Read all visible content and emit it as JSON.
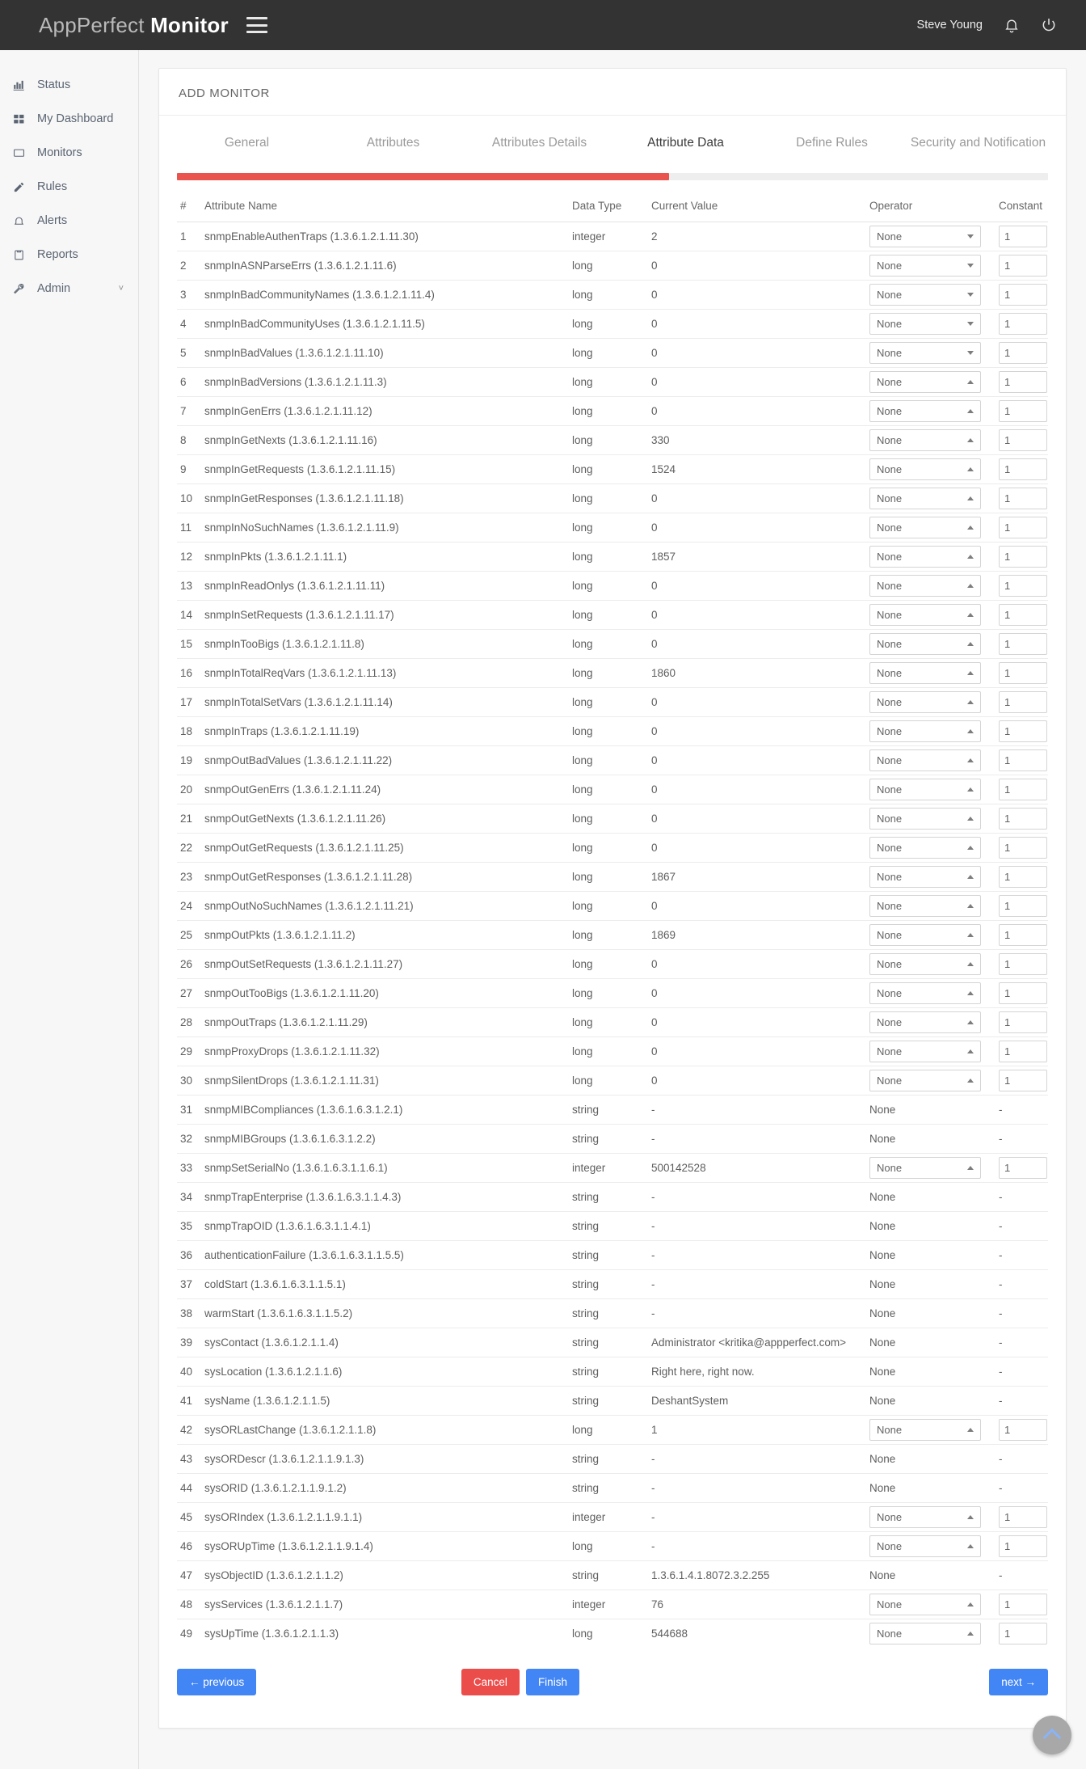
{
  "topbar": {
    "brand_light": "AppPerfect ",
    "brand_bold": "Monitor",
    "menu_icon": "hamburger-icon",
    "user_name": "Steve Young",
    "bell_icon": "bell-icon",
    "power_icon": "power-icon"
  },
  "sidebar": {
    "items": [
      {
        "label": "Status",
        "icon": "chart-bar-icon",
        "caret": ""
      },
      {
        "label": "My Dashboard",
        "icon": "grid-icon",
        "caret": ""
      },
      {
        "label": "Monitors",
        "icon": "monitor-icon",
        "caret": ""
      },
      {
        "label": "Rules",
        "icon": "pencil-icon",
        "caret": ""
      },
      {
        "label": "Alerts",
        "icon": "bell-icon",
        "caret": ""
      },
      {
        "label": "Reports",
        "icon": "clipboard-icon",
        "caret": ""
      },
      {
        "label": "Admin",
        "icon": "wrench-icon",
        "caret": "˅"
      }
    ]
  },
  "card": {
    "title": "ADD MONITOR",
    "tabs": [
      {
        "label": "General",
        "active": false
      },
      {
        "label": "Attributes",
        "active": false
      },
      {
        "label": "Attributes Details",
        "active": false
      },
      {
        "label": "Attribute Data",
        "active": true
      },
      {
        "label": "Define Rules",
        "active": false
      },
      {
        "label": "Security and Notification",
        "active": false
      }
    ],
    "progress_percent": 56.5,
    "progress_color": "#e9544f"
  },
  "table": {
    "headers": [
      "#",
      "Attribute Name",
      "Data Type",
      "Current Value",
      "Operator",
      "Constant"
    ],
    "operator_default": "None",
    "constant_default": "1",
    "dash": "-",
    "rows": [
      {
        "n": "1",
        "name": "snmpEnableAuthenTraps (1.3.6.1.2.1.11.30)",
        "type": "integer",
        "value": "2",
        "op": "None",
        "const": "1",
        "editable": true,
        "arrow": "down"
      },
      {
        "n": "2",
        "name": "snmpInASNParseErrs (1.3.6.1.2.1.11.6)",
        "type": "long",
        "value": "0",
        "op": "None",
        "const": "1",
        "editable": true,
        "arrow": "down"
      },
      {
        "n": "3",
        "name": "snmpInBadCommunityNames (1.3.6.1.2.1.11.4)",
        "type": "long",
        "value": "0",
        "op": "None",
        "const": "1",
        "editable": true,
        "arrow": "down"
      },
      {
        "n": "4",
        "name": "snmpInBadCommunityUses (1.3.6.1.2.1.11.5)",
        "type": "long",
        "value": "0",
        "op": "None",
        "const": "1",
        "editable": true,
        "arrow": "down"
      },
      {
        "n": "5",
        "name": "snmpInBadValues (1.3.6.1.2.1.11.10)",
        "type": "long",
        "value": "0",
        "op": "None",
        "const": "1",
        "editable": true,
        "arrow": "down"
      },
      {
        "n": "6",
        "name": "snmpInBadVersions (1.3.6.1.2.1.11.3)",
        "type": "long",
        "value": "0",
        "op": "None",
        "const": "1",
        "editable": true,
        "arrow": "up"
      },
      {
        "n": "7",
        "name": "snmpInGenErrs (1.3.6.1.2.1.11.12)",
        "type": "long",
        "value": "0",
        "op": "None",
        "const": "1",
        "editable": true,
        "arrow": "up"
      },
      {
        "n": "8",
        "name": "snmpInGetNexts (1.3.6.1.2.1.11.16)",
        "type": "long",
        "value": "330",
        "op": "None",
        "const": "1",
        "editable": true,
        "arrow": "up"
      },
      {
        "n": "9",
        "name": "snmpInGetRequests (1.3.6.1.2.1.11.15)",
        "type": "long",
        "value": "1524",
        "op": "None",
        "const": "1",
        "editable": true,
        "arrow": "up"
      },
      {
        "n": "10",
        "name": "snmpInGetResponses (1.3.6.1.2.1.11.18)",
        "type": "long",
        "value": "0",
        "op": "None",
        "const": "1",
        "editable": true,
        "arrow": "up"
      },
      {
        "n": "11",
        "name": "snmpInNoSuchNames (1.3.6.1.2.1.11.9)",
        "type": "long",
        "value": "0",
        "op": "None",
        "const": "1",
        "editable": true,
        "arrow": "up"
      },
      {
        "n": "12",
        "name": "snmpInPkts (1.3.6.1.2.1.11.1)",
        "type": "long",
        "value": "1857",
        "op": "None",
        "const": "1",
        "editable": true,
        "arrow": "up"
      },
      {
        "n": "13",
        "name": "snmpInReadOnlys (1.3.6.1.2.1.11.11)",
        "type": "long",
        "value": "0",
        "op": "None",
        "const": "1",
        "editable": true,
        "arrow": "up"
      },
      {
        "n": "14",
        "name": "snmpInSetRequests (1.3.6.1.2.1.11.17)",
        "type": "long",
        "value": "0",
        "op": "None",
        "const": "1",
        "editable": true,
        "arrow": "up"
      },
      {
        "n": "15",
        "name": "snmpInTooBigs (1.3.6.1.2.1.11.8)",
        "type": "long",
        "value": "0",
        "op": "None",
        "const": "1",
        "editable": true,
        "arrow": "up"
      },
      {
        "n": "16",
        "name": "snmpInTotalReqVars (1.3.6.1.2.1.11.13)",
        "type": "long",
        "value": "1860",
        "op": "None",
        "const": "1",
        "editable": true,
        "arrow": "up"
      },
      {
        "n": "17",
        "name": "snmpInTotalSetVars (1.3.6.1.2.1.11.14)",
        "type": "long",
        "value": "0",
        "op": "None",
        "const": "1",
        "editable": true,
        "arrow": "up"
      },
      {
        "n": "18",
        "name": "snmpInTraps (1.3.6.1.2.1.11.19)",
        "type": "long",
        "value": "0",
        "op": "None",
        "const": "1",
        "editable": true,
        "arrow": "up"
      },
      {
        "n": "19",
        "name": "snmpOutBadValues (1.3.6.1.2.1.11.22)",
        "type": "long",
        "value": "0",
        "op": "None",
        "const": "1",
        "editable": true,
        "arrow": "up"
      },
      {
        "n": "20",
        "name": "snmpOutGenErrs (1.3.6.1.2.1.11.24)",
        "type": "long",
        "value": "0",
        "op": "None",
        "const": "1",
        "editable": true,
        "arrow": "up"
      },
      {
        "n": "21",
        "name": "snmpOutGetNexts (1.3.6.1.2.1.11.26)",
        "type": "long",
        "value": "0",
        "op": "None",
        "const": "1",
        "editable": true,
        "arrow": "up"
      },
      {
        "n": "22",
        "name": "snmpOutGetRequests (1.3.6.1.2.1.11.25)",
        "type": "long",
        "value": "0",
        "op": "None",
        "const": "1",
        "editable": true,
        "arrow": "up"
      },
      {
        "n": "23",
        "name": "snmpOutGetResponses (1.3.6.1.2.1.11.28)",
        "type": "long",
        "value": "1867",
        "op": "None",
        "const": "1",
        "editable": true,
        "arrow": "up"
      },
      {
        "n": "24",
        "name": "snmpOutNoSuchNames (1.3.6.1.2.1.11.21)",
        "type": "long",
        "value": "0",
        "op": "None",
        "const": "1",
        "editable": true,
        "arrow": "up"
      },
      {
        "n": "25",
        "name": "snmpOutPkts (1.3.6.1.2.1.11.2)",
        "type": "long",
        "value": "1869",
        "op": "None",
        "const": "1",
        "editable": true,
        "arrow": "up"
      },
      {
        "n": "26",
        "name": "snmpOutSetRequests (1.3.6.1.2.1.11.27)",
        "type": "long",
        "value": "0",
        "op": "None",
        "const": "1",
        "editable": true,
        "arrow": "up"
      },
      {
        "n": "27",
        "name": "snmpOutTooBigs (1.3.6.1.2.1.11.20)",
        "type": "long",
        "value": "0",
        "op": "None",
        "const": "1",
        "editable": true,
        "arrow": "up"
      },
      {
        "n": "28",
        "name": "snmpOutTraps (1.3.6.1.2.1.11.29)",
        "type": "long",
        "value": "0",
        "op": "None",
        "const": "1",
        "editable": true,
        "arrow": "up"
      },
      {
        "n": "29",
        "name": "snmpProxyDrops (1.3.6.1.2.1.11.32)",
        "type": "long",
        "value": "0",
        "op": "None",
        "const": "1",
        "editable": true,
        "arrow": "up"
      },
      {
        "n": "30",
        "name": "snmpSilentDrops (1.3.6.1.2.1.11.31)",
        "type": "long",
        "value": "0",
        "op": "None",
        "const": "1",
        "editable": true,
        "arrow": "up"
      },
      {
        "n": "31",
        "name": "snmpMIBCompliances (1.3.6.1.6.3.1.2.1)",
        "type": "string",
        "value": "-",
        "op": "None",
        "const": "-",
        "editable": false,
        "arrow": ""
      },
      {
        "n": "32",
        "name": "snmpMIBGroups (1.3.6.1.6.3.1.2.2)",
        "type": "string",
        "value": "-",
        "op": "None",
        "const": "-",
        "editable": false,
        "arrow": ""
      },
      {
        "n": "33",
        "name": "snmpSetSerialNo (1.3.6.1.6.3.1.1.6.1)",
        "type": "integer",
        "value": "500142528",
        "op": "None",
        "const": "1",
        "editable": true,
        "arrow": "up"
      },
      {
        "n": "34",
        "name": "snmpTrapEnterprise (1.3.6.1.6.3.1.1.4.3)",
        "type": "string",
        "value": "-",
        "op": "None",
        "const": "-",
        "editable": false,
        "arrow": ""
      },
      {
        "n": "35",
        "name": "snmpTrapOID (1.3.6.1.6.3.1.1.4.1)",
        "type": "string",
        "value": "-",
        "op": "None",
        "const": "-",
        "editable": false,
        "arrow": ""
      },
      {
        "n": "36",
        "name": "authenticationFailure (1.3.6.1.6.3.1.1.5.5)",
        "type": "string",
        "value": "-",
        "op": "None",
        "const": "-",
        "editable": false,
        "arrow": ""
      },
      {
        "n": "37",
        "name": "coldStart (1.3.6.1.6.3.1.1.5.1)",
        "type": "string",
        "value": "-",
        "op": "None",
        "const": "-",
        "editable": false,
        "arrow": ""
      },
      {
        "n": "38",
        "name": "warmStart (1.3.6.1.6.3.1.1.5.2)",
        "type": "string",
        "value": "-",
        "op": "None",
        "const": "-",
        "editable": false,
        "arrow": ""
      },
      {
        "n": "39",
        "name": "sysContact (1.3.6.1.2.1.1.4)",
        "type": "string",
        "value": "Administrator <kritika@appperfect.com>",
        "op": "None",
        "const": "-",
        "editable": false,
        "arrow": ""
      },
      {
        "n": "40",
        "name": "sysLocation (1.3.6.1.2.1.1.6)",
        "type": "string",
        "value": "Right here, right now.",
        "op": "None",
        "const": "-",
        "editable": false,
        "arrow": ""
      },
      {
        "n": "41",
        "name": "sysName (1.3.6.1.2.1.1.5)",
        "type": "string",
        "value": "DeshantSystem",
        "op": "None",
        "const": "-",
        "editable": false,
        "arrow": ""
      },
      {
        "n": "42",
        "name": "sysORLastChange (1.3.6.1.2.1.1.8)",
        "type": "long",
        "value": "1",
        "op": "None",
        "const": "1",
        "editable": true,
        "arrow": "up"
      },
      {
        "n": "43",
        "name": "sysORDescr (1.3.6.1.2.1.1.9.1.3)",
        "type": "string",
        "value": "-",
        "op": "None",
        "const": "-",
        "editable": false,
        "arrow": ""
      },
      {
        "n": "44",
        "name": "sysORID (1.3.6.1.2.1.1.9.1.2)",
        "type": "string",
        "value": "-",
        "op": "None",
        "const": "-",
        "editable": false,
        "arrow": ""
      },
      {
        "n": "45",
        "name": "sysORIndex (1.3.6.1.2.1.1.9.1.1)",
        "type": "integer",
        "value": "-",
        "op": "None",
        "const": "1",
        "editable": true,
        "arrow": "up"
      },
      {
        "n": "46",
        "name": "sysORUpTime (1.3.6.1.2.1.1.9.1.4)",
        "type": "long",
        "value": "-",
        "op": "None",
        "const": "1",
        "editable": true,
        "arrow": "up"
      },
      {
        "n": "47",
        "name": "sysObjectID (1.3.6.1.2.1.1.2)",
        "type": "string",
        "value": "1.3.6.1.4.1.8072.3.2.255",
        "op": "None",
        "const": "-",
        "editable": false,
        "arrow": ""
      },
      {
        "n": "48",
        "name": "sysServices (1.3.6.1.2.1.1.7)",
        "type": "integer",
        "value": "76",
        "op": "None",
        "const": "1",
        "editable": true,
        "arrow": "up"
      },
      {
        "n": "49",
        "name": "sysUpTime (1.3.6.1.2.1.1.3)",
        "type": "long",
        "value": "544688",
        "op": "None",
        "const": "1",
        "editable": true,
        "arrow": "up"
      }
    ]
  },
  "footer": {
    "previous_label": "← previous",
    "cancel_label": "Cancel",
    "finish_label": "Finish",
    "next_label": "next →",
    "scroll_top_icon": "chevron-up-icon"
  }
}
